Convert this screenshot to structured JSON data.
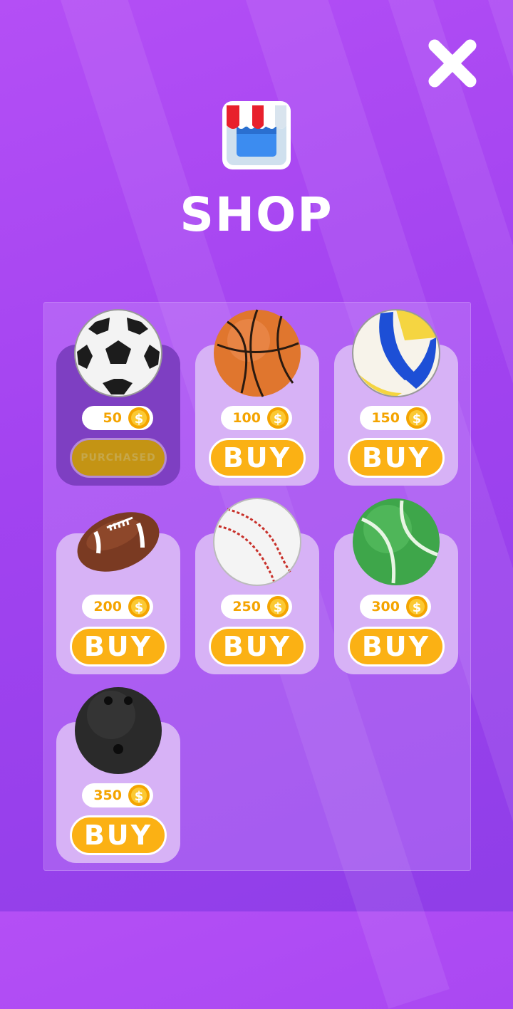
{
  "header": {
    "title": "SHOP"
  },
  "colors": {
    "background": "#a243f0",
    "card": "#d7b2f6",
    "card_owned": "#7e3fc2",
    "button": "#fbb114",
    "price": "#f4a400"
  },
  "items": [
    {
      "name": "soccer-ball",
      "price": "50",
      "button": "PURCHASED",
      "owned": true
    },
    {
      "name": "basketball",
      "price": "100",
      "button": "BUY",
      "owned": false
    },
    {
      "name": "volleyball",
      "price": "150",
      "button": "BUY",
      "owned": false
    },
    {
      "name": "american-football",
      "price": "200",
      "button": "BUY",
      "owned": false
    },
    {
      "name": "baseball",
      "price": "250",
      "button": "BUY",
      "owned": false
    },
    {
      "name": "tennis-ball",
      "price": "300",
      "button": "BUY",
      "owned": false
    },
    {
      "name": "bowling-ball",
      "price": "350",
      "button": "BUY",
      "owned": false
    }
  ]
}
